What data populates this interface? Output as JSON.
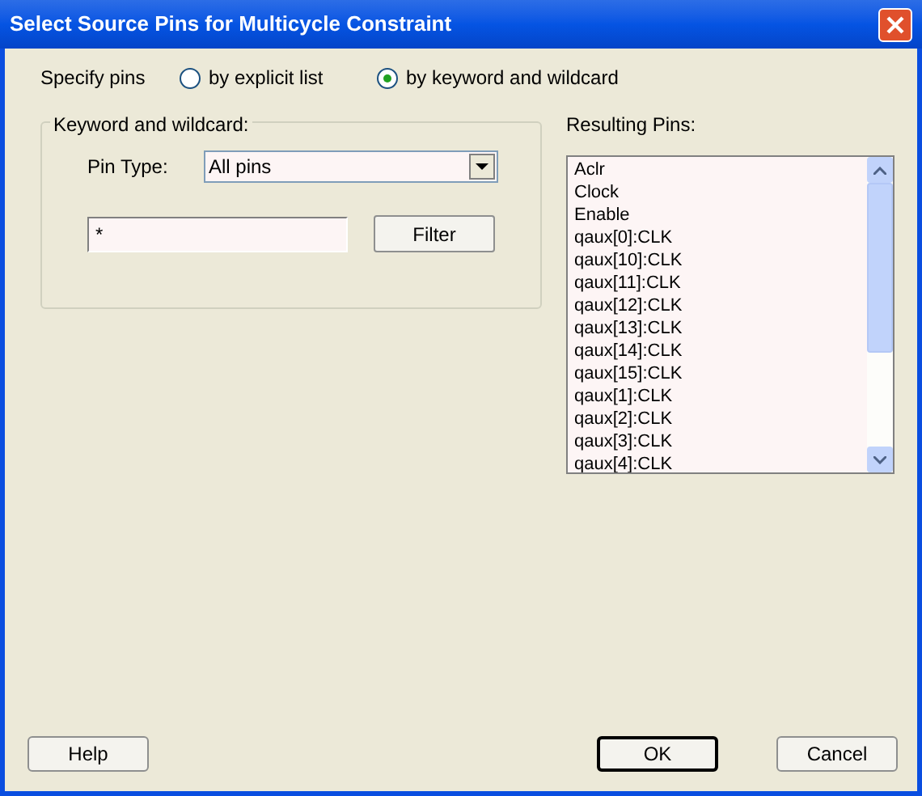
{
  "window": {
    "title": "Select Source Pins for Multicycle Constraint"
  },
  "specify": {
    "label": "Specify pins",
    "options": [
      {
        "label": "by explicit list",
        "selected": false
      },
      {
        "label": "by keyword and wildcard",
        "selected": true
      }
    ]
  },
  "group": {
    "title": "Keyword and wildcard:",
    "pin_type_label": "Pin Type:",
    "pin_type_value": "All pins",
    "filter_value": "*",
    "filter_button": "Filter"
  },
  "results": {
    "label": "Resulting Pins:",
    "items": [
      "Aclr",
      "Clock",
      "Enable",
      "qaux[0]:CLK",
      "qaux[10]:CLK",
      "qaux[11]:CLK",
      "qaux[12]:CLK",
      "qaux[13]:CLK",
      "qaux[14]:CLK",
      "qaux[15]:CLK",
      "qaux[1]:CLK",
      "qaux[2]:CLK",
      "qaux[3]:CLK",
      "qaux[4]:CLK"
    ]
  },
  "buttons": [
    {
      "label": "Help",
      "default": false
    },
    {
      "label": "OK",
      "default": true
    },
    {
      "label": "Cancel",
      "default": false
    }
  ]
}
